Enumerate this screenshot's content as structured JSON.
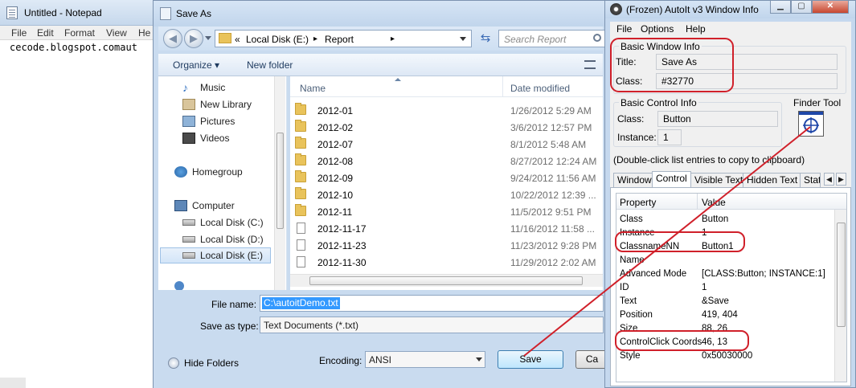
{
  "notepad": {
    "title": "Untitled - Notepad",
    "menu": [
      "File",
      "Edit",
      "Format",
      "View",
      "He"
    ],
    "text": "cecode.blogspot.comaut"
  },
  "saveas": {
    "title": "Save As",
    "path_prefix": "«",
    "path_segments": [
      "Local Disk (E:)",
      "Report"
    ],
    "path_sep": "▸",
    "search_placeholder": "Search Report",
    "organize_label": "Organize ▾",
    "new_folder_label": "New folder",
    "nav": [
      {
        "label": "Music",
        "icon": "music-icon"
      },
      {
        "label": "New Library",
        "icon": "library-icon"
      },
      {
        "label": "Pictures",
        "icon": "pictures-icon"
      },
      {
        "label": "Videos",
        "icon": "videos-icon"
      },
      {
        "label": "Homegroup",
        "icon": "homegroup-icon"
      },
      {
        "label": "Computer",
        "icon": "computer-icon"
      },
      {
        "label": "Local Disk (C:)",
        "icon": "drive-icon"
      },
      {
        "label": "Local Disk (D:)",
        "icon": "drive-icon"
      },
      {
        "label": "Local Disk (E:)",
        "icon": "drive-icon"
      }
    ],
    "columns": {
      "name": "Name",
      "date": "Date modified"
    },
    "files": [
      {
        "name": "2012-01",
        "date": "1/26/2012 5:29 AM",
        "type": "folder"
      },
      {
        "name": "2012-02",
        "date": "3/6/2012 12:57 PM",
        "type": "folder"
      },
      {
        "name": "2012-07",
        "date": "8/1/2012 5:48 AM",
        "type": "folder"
      },
      {
        "name": "2012-08",
        "date": "8/27/2012 12:24 AM",
        "type": "folder"
      },
      {
        "name": "2012-09",
        "date": "9/24/2012 11:56 AM",
        "type": "folder"
      },
      {
        "name": "2012-10",
        "date": "10/22/2012 12:39 ...",
        "type": "folder"
      },
      {
        "name": "2012-11",
        "date": "11/5/2012 9:51 PM",
        "type": "folder"
      },
      {
        "name": "2012-11-17",
        "date": "11/16/2012 11:58 ...",
        "type": "file"
      },
      {
        "name": "2012-11-23",
        "date": "11/23/2012 9:28 PM",
        "type": "file"
      },
      {
        "name": "2012-11-30",
        "date": "11/29/2012 2:02 AM",
        "type": "file"
      }
    ],
    "file_name_label": "File name:",
    "file_name_value": "C:\\autoitDemo.txt",
    "save_type_label": "Save as type:",
    "save_type_value": "Text Documents (*.txt)",
    "hide_folders_label": "Hide Folders",
    "encoding_label": "Encoding:",
    "encoding_value": "ANSI",
    "save_button": "Save",
    "cancel_button": "Ca"
  },
  "autoit": {
    "title": "(Frozen) AutoIt v3 Window Info",
    "menu": [
      "File",
      "Options",
      "Help"
    ],
    "basic_window_info": "Basic Window Info",
    "title_label": "Title:",
    "title_value": "Save As",
    "class_label": "Class:",
    "class_value": "#32770",
    "basic_control_info": "Basic Control Info",
    "ctrl_class_label": "Class:",
    "ctrl_class_value": "Button",
    "instance_label": "Instance:",
    "instance_value": "1",
    "finder_tool": "Finder Tool",
    "hint": "(Double-click list entries to copy to clipboard)",
    "tabs": [
      "Window",
      "Control",
      "Visible Text",
      "Hidden Text",
      "Stat"
    ],
    "active_tab": "Control",
    "list_headers": {
      "property": "Property",
      "value": "Value"
    },
    "properties": [
      {
        "key": "Class",
        "value": "Button"
      },
      {
        "key": "Instance",
        "value": "1"
      },
      {
        "key": "ClassnameNN",
        "value": "Button1"
      },
      {
        "key": "Name",
        "value": ""
      },
      {
        "key": "Advanced Mode",
        "value": "[CLASS:Button; INSTANCE:1]"
      },
      {
        "key": "ID",
        "value": "1"
      },
      {
        "key": "Text",
        "value": "&Save"
      },
      {
        "key": "Position",
        "value": "419, 404"
      },
      {
        "key": "Size",
        "value": "88, 26"
      },
      {
        "key": "ControlClick Coords",
        "value": "46, 13"
      },
      {
        "key": "Style",
        "value": "0x50030000"
      }
    ]
  },
  "colors": {
    "annotation": "#d0202a",
    "selection": "#3399ff",
    "chrome": "#c9dbef"
  }
}
